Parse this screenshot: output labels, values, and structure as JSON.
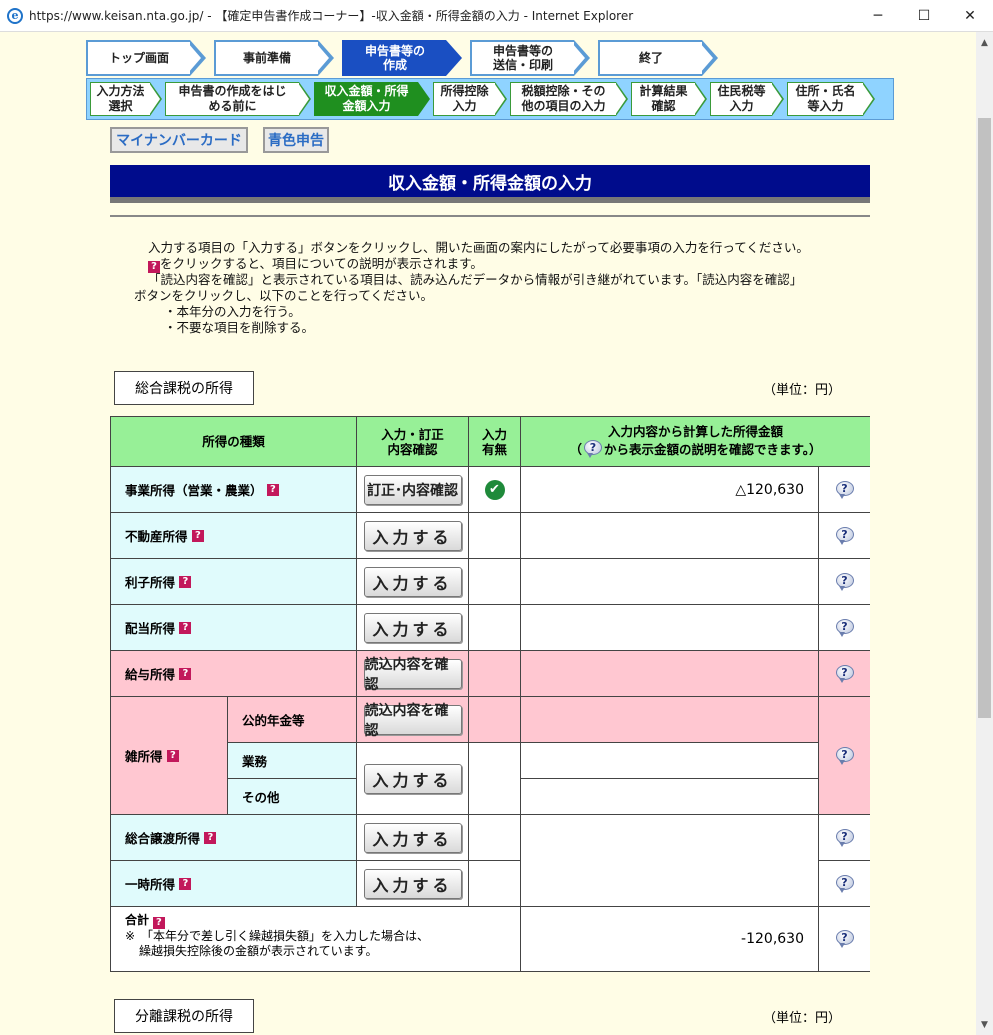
{
  "window": {
    "title": "https://www.keisan.nta.go.jp/ - 【確定申告書作成コーナー】-収入金額・所得金額の入力 - Internet Explorer",
    "minimize": "─",
    "maximize": "☐",
    "close": "✕"
  },
  "steps": [
    "トップ画面",
    "事前準備",
    "申告書等の作成",
    "申告書等の送信・印刷",
    "終了"
  ],
  "steps_lines": [
    [
      "トップ画面"
    ],
    [
      "事前準備"
    ],
    [
      "申告書等の",
      "作成"
    ],
    [
      "申告書等の",
      "送信・印刷"
    ],
    [
      "終了"
    ]
  ],
  "substeps": [
    [
      "入力方法",
      "選択"
    ],
    [
      "申告書の作成をはじ",
      "める前に"
    ],
    [
      "収入金額・所得",
      "金額入力"
    ],
    [
      "所得控除",
      "入力"
    ],
    [
      "税額控除・その",
      "他の項目の入力"
    ],
    [
      "計算結果",
      "確認"
    ],
    [
      "住民税等",
      "入力"
    ],
    [
      "住所・氏名",
      "等入力"
    ]
  ],
  "mode_buttons": {
    "mynumber": "マイナンバーカード",
    "blue": "青色申告"
  },
  "page_title": "収入金額・所得金額の入力",
  "instructions": {
    "line1": "入力する項目の「入力する」ボタンをクリックし、開いた画面の案内にしたがって必要事項の入力を行ってください。",
    "line2": "をクリックすると、項目についての説明が表示されます。",
    "line3": "「読込内容を確認」と表示されている項目は、読み込んだデータから情報が引き継がれています。「読込内容を確認」",
    "line4": "ボタンをクリックし、以下のことを行ってください。",
    "line5": "・本年分の入力を行う。",
    "line6": "・不要な項目を削除する。"
  },
  "sections": {
    "general": "総合課税の所得",
    "separate": "分離課税の所得",
    "unit": "（単位：円）"
  },
  "table": {
    "headers": {
      "kind": "所得の種類",
      "entry_line1": "入力・訂正",
      "entry_line2": "内容確認",
      "status_line1": "入力",
      "status_line2": "有無",
      "amount_line1": "入力内容から計算した所得金額",
      "amount_line2a": "（",
      "amount_line2b": "から表示金額の説明を確認できます。）"
    },
    "rows": {
      "business": {
        "label": "事業所得（営業・農業）",
        "button": "訂正･内容確認",
        "value": "△120,630"
      },
      "real_estate": {
        "label": "不動産所得",
        "button": "入力する"
      },
      "interest": {
        "label": "利子所得",
        "button": "入力する"
      },
      "dividend": {
        "label": "配当所得",
        "button": "入力する"
      },
      "salary": {
        "label": "給与所得",
        "button": "読込内容を確認"
      },
      "misc": {
        "label": "雑所得",
        "pension": "公的年金等",
        "pension_button": "読込内容を確認",
        "work": "業務",
        "other": "その他",
        "button": "入力する"
      },
      "transfer": {
        "label": "総合譲渡所得",
        "button": "入力する"
      },
      "temporary": {
        "label": "一時所得",
        "button": "入力する"
      },
      "total": {
        "label": "合計",
        "note1": "※　「本年分で差し引く繰越損失額」を入力した場合は、",
        "note2": "繰越損失控除後の金額が表示されています。",
        "value": "-120,630"
      }
    }
  },
  "icons": {
    "help": "?",
    "check": "✔"
  }
}
